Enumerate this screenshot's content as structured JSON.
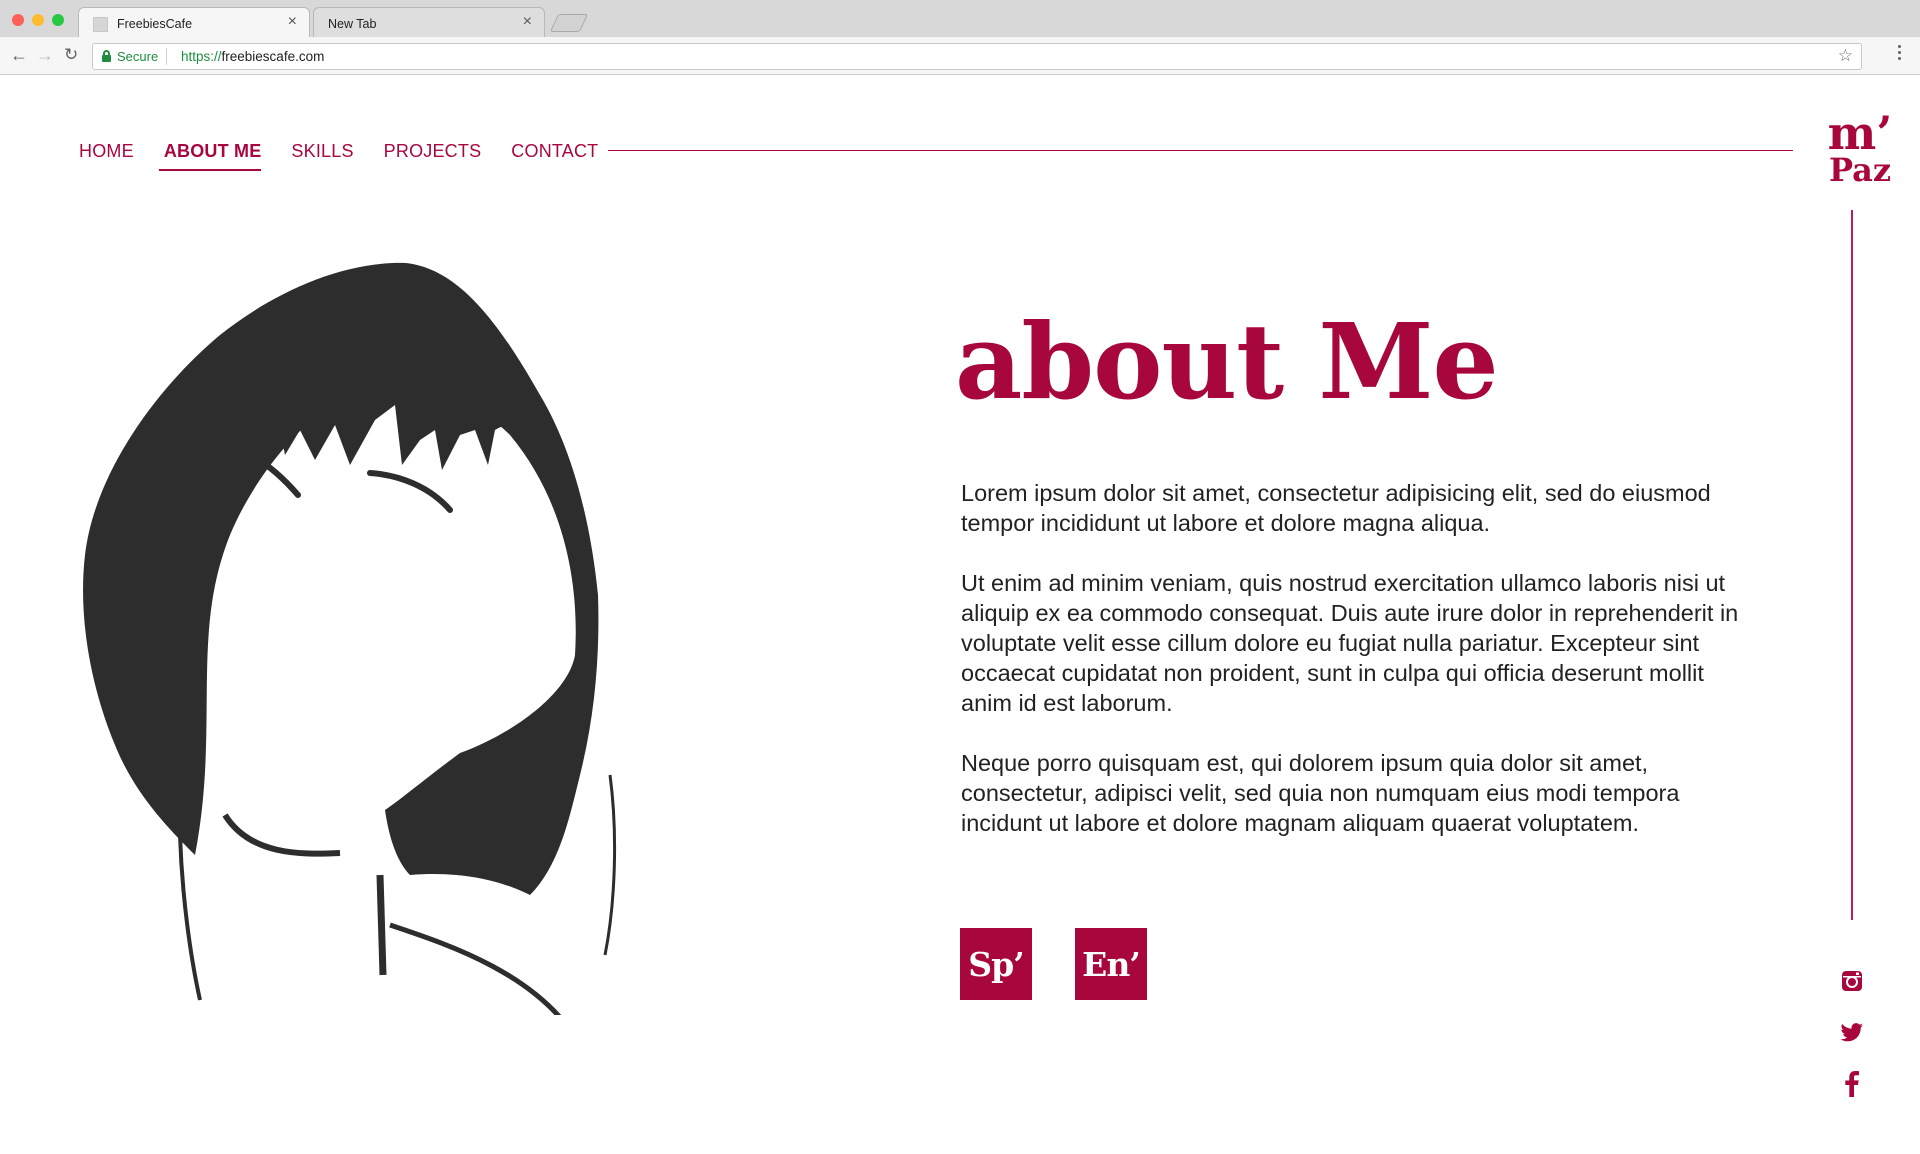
{
  "browser": {
    "tabs": [
      {
        "title": "FreebiesCafe",
        "active": true
      },
      {
        "title": "New Tab",
        "active": false
      }
    ],
    "secure_label": "Secure",
    "url_scheme": "https://",
    "url_host": "freebiescafe.com"
  },
  "nav": {
    "items": [
      "HOME",
      "ABOUT ME",
      "SKILLS",
      "PROJECTS",
      "CONTACT"
    ],
    "active": "ABOUT ME"
  },
  "logo": {
    "top": "m’",
    "bottom": "Paz"
  },
  "headline": "about Me",
  "paragraphs": [
    "Lorem ipsum dolor sit amet, consectetur adipisicing elit, sed do eiusmod tempor incididunt ut labore et dolore magna aliqua.",
    "Ut enim ad minim veniam, quis nostrud exercitation ullamco laboris nisi ut aliquip ex ea commodo consequat. Duis aute irure dolor in reprehenderit in voluptate velit esse cillum dolore eu fugiat nulla pariatur. Excepteur sint occaecat cupidatat non proident, sunt in culpa qui officia deserunt mollit anim id est laborum.",
    "Neque porro quisquam est, qui dolorem ipsum quia dolor sit amet, consectetur, adipisci velit, sed quia non numquam eius modi tempora incidunt ut labore et dolore magnam aliquam quaerat voluptatem."
  ],
  "languages": {
    "spanish": "Sp’",
    "english": "En’"
  },
  "social": [
    "instagram-icon",
    "twitter-icon",
    "facebook-icon"
  ],
  "colors": {
    "accent": "#a8073d",
    "text": "#222222",
    "portrait": "#2d2d2d"
  }
}
